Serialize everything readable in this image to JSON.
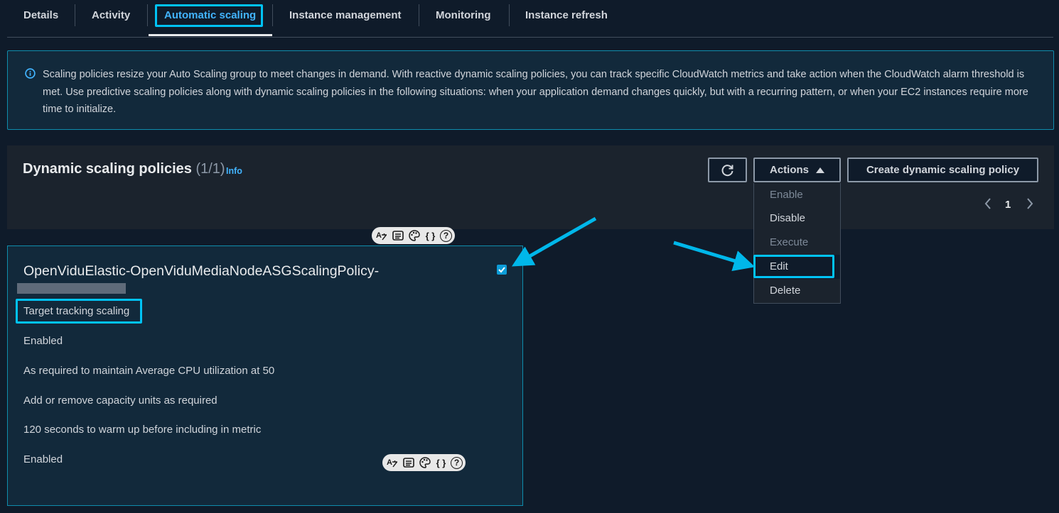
{
  "tabs": [
    {
      "label": "Details"
    },
    {
      "label": "Activity"
    },
    {
      "label": "Automatic scaling"
    },
    {
      "label": "Instance management"
    },
    {
      "label": "Monitoring"
    },
    {
      "label": "Instance refresh"
    }
  ],
  "active_tab": "Automatic scaling",
  "alert": {
    "icon": "info-circle-icon",
    "text": "Scaling policies resize your Auto Scaling group to meet changes in demand. With reactive dynamic scaling policies, you can track specific CloudWatch metrics and take action when the CloudWatch alarm threshold is met. Use predictive scaling policies along with dynamic scaling policies in the following situations: when your application demand changes quickly, but with a recurring pattern, or when your EC2 instances require more time to initialize."
  },
  "panel": {
    "title": "Dynamic scaling policies",
    "count": "(1/1)",
    "info_link": "Info",
    "actions_label": "Actions",
    "create_label": "Create dynamic scaling policy",
    "page_number": "1"
  },
  "actions_menu": [
    {
      "label": "Enable",
      "disabled": true
    },
    {
      "label": "Disable",
      "disabled": false
    },
    {
      "label": "Execute",
      "disabled": true
    },
    {
      "label": "Edit",
      "disabled": false
    },
    {
      "label": "Delete",
      "disabled": false
    }
  ],
  "policy": {
    "name": "OpenViduElastic-OpenViduMediaNodeASGScalingPolicy-",
    "type": "Target tracking scaling",
    "status": "Enabled",
    "target": "As required to maintain Average CPU utilization at 50",
    "capacity": "Add or remove capacity units as required",
    "warmup": "120 seconds to warm up before including in metric",
    "scale_in": "Enabled",
    "selected": true
  },
  "colors": {
    "background": "#0f1b2a",
    "accent": "#42b4ff",
    "highlight": "#00c3f5",
    "card": "#12293b"
  }
}
